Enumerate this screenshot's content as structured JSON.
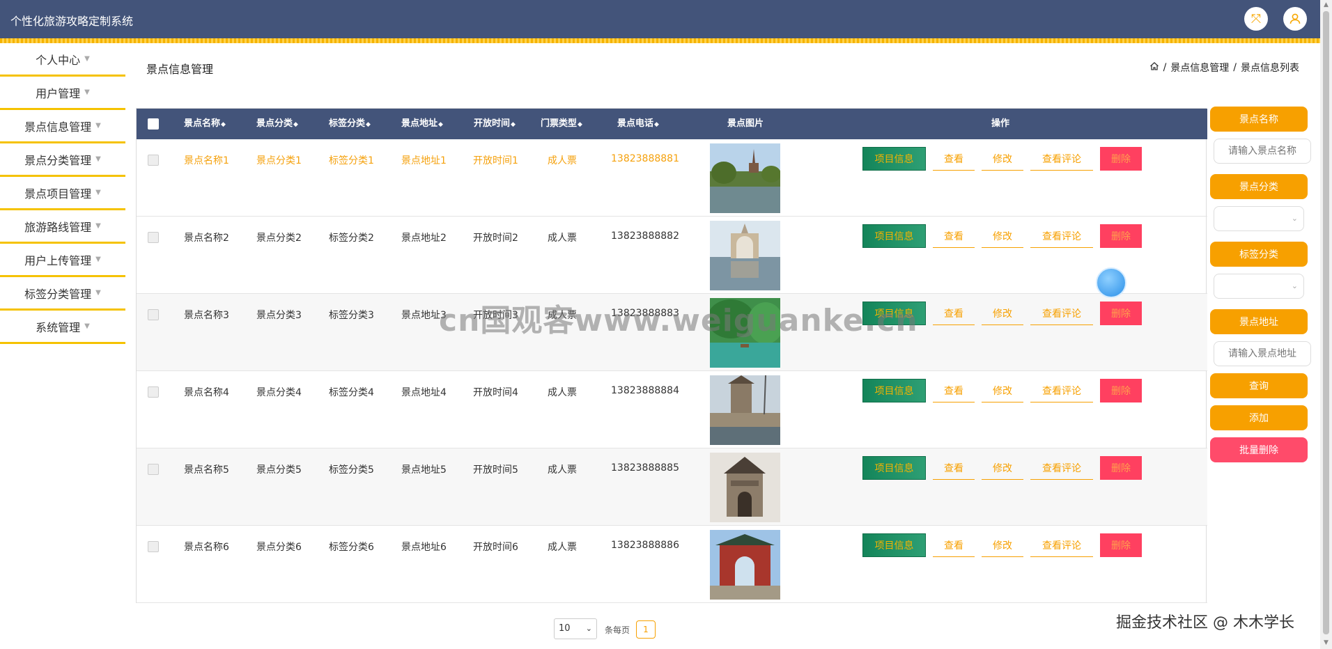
{
  "app": {
    "title": "个性化旅游攻略定制系统"
  },
  "topbar": {
    "fullscreen_icon": "expand-icon",
    "user_icon": "user-icon"
  },
  "sidebar": {
    "items": [
      {
        "label": "个人中心"
      },
      {
        "label": "用户管理"
      },
      {
        "label": "景点信息管理"
      },
      {
        "label": "景点分类管理"
      },
      {
        "label": "景点项目管理"
      },
      {
        "label": "旅游路线管理"
      },
      {
        "label": "用户上传管理"
      },
      {
        "label": "标签分类管理"
      },
      {
        "label": "系统管理"
      }
    ]
  },
  "page": {
    "title": "景点信息管理"
  },
  "breadcrumb": {
    "home_icon": "home-icon",
    "level1": "景点信息管理",
    "sep": "/",
    "level2": "景点信息列表"
  },
  "table": {
    "headers": [
      "景点名称",
      "景点分类",
      "标签分类",
      "景点地址",
      "开放时间",
      "门票类型",
      "景点电话",
      "景点图片",
      "操作"
    ],
    "actions": {
      "project": "项目信息",
      "view": "查看",
      "edit": "修改",
      "review": "查看评论",
      "delete": "删除"
    },
    "rows": [
      {
        "name": "景点名称1",
        "category": "景点分类1",
        "tag": "标签分类1",
        "address": "景点地址1",
        "open": "开放时间1",
        "ticket": "成人票",
        "phone": "13823888881"
      },
      {
        "name": "景点名称2",
        "category": "景点分类2",
        "tag": "标签分类2",
        "address": "景点地址2",
        "open": "开放时间2",
        "ticket": "成人票",
        "phone": "13823888882"
      },
      {
        "name": "景点名称3",
        "category": "景点分类3",
        "tag": "标签分类3",
        "address": "景点地址3",
        "open": "开放时间3",
        "ticket": "成人票",
        "phone": "13823888883"
      },
      {
        "name": "景点名称4",
        "category": "景点分类4",
        "tag": "标签分类4",
        "address": "景点地址4",
        "open": "开放时间4",
        "ticket": "成人票",
        "phone": "13823888884"
      },
      {
        "name": "景点名称5",
        "category": "景点分类5",
        "tag": "标签分类5",
        "address": "景点地址5",
        "open": "开放时间5",
        "ticket": "成人票",
        "phone": "13823888885"
      },
      {
        "name": "景点名称6",
        "category": "景点分类6",
        "tag": "标签分类6",
        "address": "景点地址6",
        "open": "开放时间6",
        "ticket": "成人票",
        "phone": "13823888886"
      }
    ]
  },
  "search_panel": {
    "name_label": "景点名称",
    "name_placeholder": "请输入景点名称",
    "category_label": "景点分类",
    "tag_label": "标签分类",
    "address_label": "景点地址",
    "address_placeholder": "请输入景点地址",
    "query": "查询",
    "add": "添加",
    "batch_delete": "批量删除"
  },
  "pagination": {
    "page_size": "10",
    "per_page_label": "条每页",
    "current_page": "1"
  },
  "overlays": {
    "watermark": "cn国观客www.weiguanke.cn",
    "credit": "掘金技术社区 @ 木木学长"
  },
  "colors": {
    "header": "#43547a",
    "accent": "#f7a000",
    "stripe": "#f5c200",
    "project_button": "#14855a",
    "delete_button": "#ff4060"
  }
}
